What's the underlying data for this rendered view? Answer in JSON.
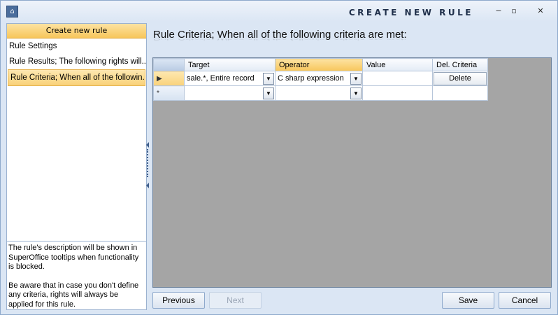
{
  "window": {
    "title": "CREATE NEW RULE",
    "app_icon": "lock-icon",
    "controls": {
      "minimize": "−",
      "restore": "▫",
      "close": "✕"
    }
  },
  "sidebar": {
    "header": "Create new rule",
    "items": [
      {
        "label": "Rule Settings",
        "selected": false
      },
      {
        "label": "Rule Results; The following rights will...",
        "selected": false
      },
      {
        "label": "Rule Criteria; When all of the followin...",
        "selected": true
      }
    ],
    "description_1": "The rule's description will be shown in SuperOffice tooltips when functionality is blocked.",
    "description_2": "Be aware that in case you don't define any criteria, rights will always be applied for this rule."
  },
  "main": {
    "title": "Rule Criteria; When all of the following criteria are met:",
    "grid": {
      "columns": [
        "Target",
        "Operator",
        "Value",
        "Del. Criteria"
      ],
      "rows": [
        {
          "marker": "▶",
          "target": "sale.*, Entire record",
          "operator": "C sharp expression",
          "value": "",
          "delete": "Delete"
        },
        {
          "marker": "*",
          "target": "",
          "operator": "",
          "value": "",
          "delete": ""
        }
      ]
    }
  },
  "footer": {
    "previous": "Previous",
    "next": "Next",
    "save": "Save",
    "cancel": "Cancel"
  },
  "colors": {
    "accent": "#f7c65b",
    "grid_bg": "#a5a5a5",
    "frame": "#dbe6f4"
  }
}
